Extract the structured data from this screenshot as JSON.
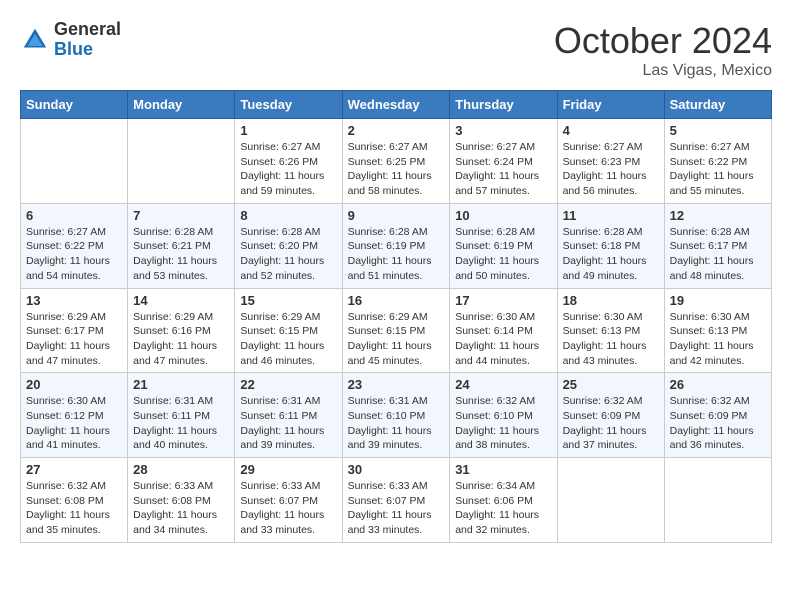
{
  "header": {
    "logo_general": "General",
    "logo_blue": "Blue",
    "month_title": "October 2024",
    "location": "Las Vigas, Mexico"
  },
  "weekdays": [
    "Sunday",
    "Monday",
    "Tuesday",
    "Wednesday",
    "Thursday",
    "Friday",
    "Saturday"
  ],
  "weeks": [
    [
      {
        "day": "",
        "info": ""
      },
      {
        "day": "",
        "info": ""
      },
      {
        "day": "1",
        "sunrise": "6:27 AM",
        "sunset": "6:26 PM",
        "daylight": "11 hours and 59 minutes."
      },
      {
        "day": "2",
        "sunrise": "6:27 AM",
        "sunset": "6:25 PM",
        "daylight": "11 hours and 58 minutes."
      },
      {
        "day": "3",
        "sunrise": "6:27 AM",
        "sunset": "6:24 PM",
        "daylight": "11 hours and 57 minutes."
      },
      {
        "day": "4",
        "sunrise": "6:27 AM",
        "sunset": "6:23 PM",
        "daylight": "11 hours and 56 minutes."
      },
      {
        "day": "5",
        "sunrise": "6:27 AM",
        "sunset": "6:22 PM",
        "daylight": "11 hours and 55 minutes."
      }
    ],
    [
      {
        "day": "6",
        "sunrise": "6:27 AM",
        "sunset": "6:22 PM",
        "daylight": "11 hours and 54 minutes."
      },
      {
        "day": "7",
        "sunrise": "6:28 AM",
        "sunset": "6:21 PM",
        "daylight": "11 hours and 53 minutes."
      },
      {
        "day": "8",
        "sunrise": "6:28 AM",
        "sunset": "6:20 PM",
        "daylight": "11 hours and 52 minutes."
      },
      {
        "day": "9",
        "sunrise": "6:28 AM",
        "sunset": "6:19 PM",
        "daylight": "11 hours and 51 minutes."
      },
      {
        "day": "10",
        "sunrise": "6:28 AM",
        "sunset": "6:19 PM",
        "daylight": "11 hours and 50 minutes."
      },
      {
        "day": "11",
        "sunrise": "6:28 AM",
        "sunset": "6:18 PM",
        "daylight": "11 hours and 49 minutes."
      },
      {
        "day": "12",
        "sunrise": "6:28 AM",
        "sunset": "6:17 PM",
        "daylight": "11 hours and 48 minutes."
      }
    ],
    [
      {
        "day": "13",
        "sunrise": "6:29 AM",
        "sunset": "6:17 PM",
        "daylight": "11 hours and 47 minutes."
      },
      {
        "day": "14",
        "sunrise": "6:29 AM",
        "sunset": "6:16 PM",
        "daylight": "11 hours and 47 minutes."
      },
      {
        "day": "15",
        "sunrise": "6:29 AM",
        "sunset": "6:15 PM",
        "daylight": "11 hours and 46 minutes."
      },
      {
        "day": "16",
        "sunrise": "6:29 AM",
        "sunset": "6:15 PM",
        "daylight": "11 hours and 45 minutes."
      },
      {
        "day": "17",
        "sunrise": "6:30 AM",
        "sunset": "6:14 PM",
        "daylight": "11 hours and 44 minutes."
      },
      {
        "day": "18",
        "sunrise": "6:30 AM",
        "sunset": "6:13 PM",
        "daylight": "11 hours and 43 minutes."
      },
      {
        "day": "19",
        "sunrise": "6:30 AM",
        "sunset": "6:13 PM",
        "daylight": "11 hours and 42 minutes."
      }
    ],
    [
      {
        "day": "20",
        "sunrise": "6:30 AM",
        "sunset": "6:12 PM",
        "daylight": "11 hours and 41 minutes."
      },
      {
        "day": "21",
        "sunrise": "6:31 AM",
        "sunset": "6:11 PM",
        "daylight": "11 hours and 40 minutes."
      },
      {
        "day": "22",
        "sunrise": "6:31 AM",
        "sunset": "6:11 PM",
        "daylight": "11 hours and 39 minutes."
      },
      {
        "day": "23",
        "sunrise": "6:31 AM",
        "sunset": "6:10 PM",
        "daylight": "11 hours and 39 minutes."
      },
      {
        "day": "24",
        "sunrise": "6:32 AM",
        "sunset": "6:10 PM",
        "daylight": "11 hours and 38 minutes."
      },
      {
        "day": "25",
        "sunrise": "6:32 AM",
        "sunset": "6:09 PM",
        "daylight": "11 hours and 37 minutes."
      },
      {
        "day": "26",
        "sunrise": "6:32 AM",
        "sunset": "6:09 PM",
        "daylight": "11 hours and 36 minutes."
      }
    ],
    [
      {
        "day": "27",
        "sunrise": "6:32 AM",
        "sunset": "6:08 PM",
        "daylight": "11 hours and 35 minutes."
      },
      {
        "day": "28",
        "sunrise": "6:33 AM",
        "sunset": "6:08 PM",
        "daylight": "11 hours and 34 minutes."
      },
      {
        "day": "29",
        "sunrise": "6:33 AM",
        "sunset": "6:07 PM",
        "daylight": "11 hours and 33 minutes."
      },
      {
        "day": "30",
        "sunrise": "6:33 AM",
        "sunset": "6:07 PM",
        "daylight": "11 hours and 33 minutes."
      },
      {
        "day": "31",
        "sunrise": "6:34 AM",
        "sunset": "6:06 PM",
        "daylight": "11 hours and 32 minutes."
      },
      {
        "day": "",
        "info": ""
      },
      {
        "day": "",
        "info": ""
      }
    ]
  ],
  "labels": {
    "sunrise": "Sunrise:",
    "sunset": "Sunset:",
    "daylight": "Daylight:"
  }
}
